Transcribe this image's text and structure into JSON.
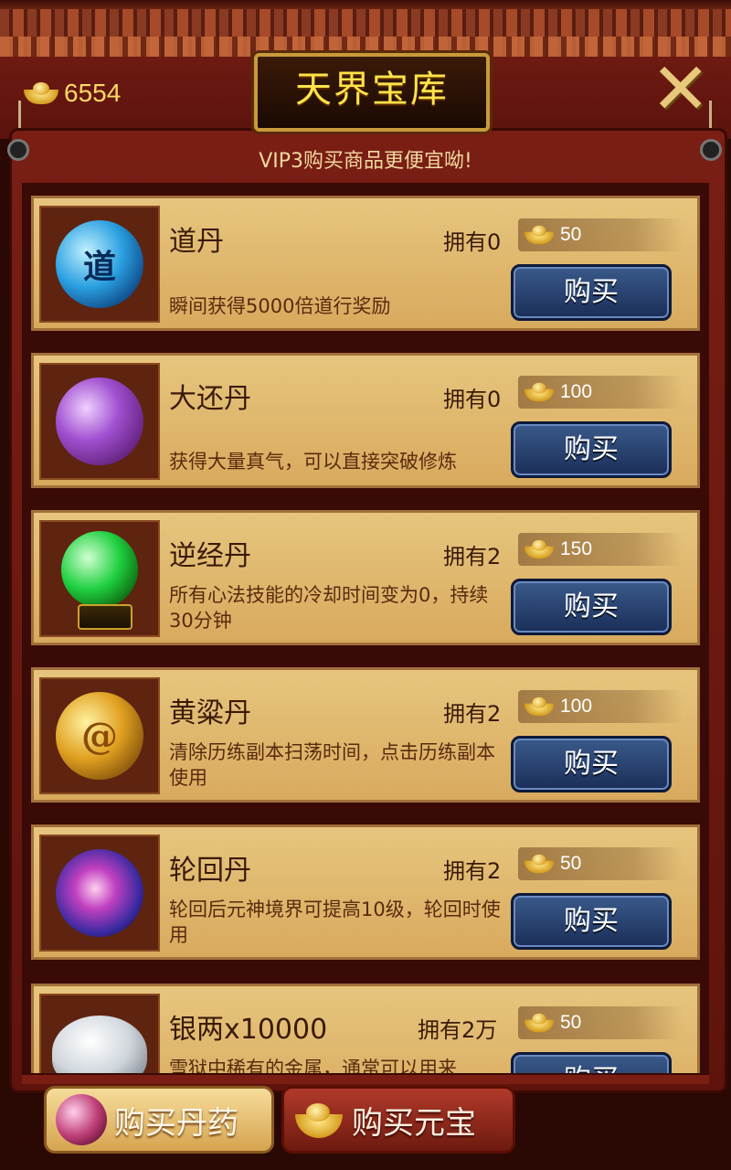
{
  "header": {
    "title": "天界宝库",
    "currency": "6554",
    "close_icon": "close-x-icon"
  },
  "vip_notice": "VIP3购买商品更便宜呦!",
  "items": [
    {
      "name": "道丹",
      "owned": "拥有0",
      "price": "50",
      "desc": "瞬间获得5000倍道行奖励",
      "icon": "blue-dan-orb-icon",
      "buy": "购买"
    },
    {
      "name": "大还丹",
      "owned": "拥有0",
      "price": "100",
      "desc": "获得大量真气，可以直接突破修炼",
      "icon": "purple-orb-icon",
      "buy": "购买"
    },
    {
      "name": "逆经丹",
      "owned": "拥有2",
      "price": "150",
      "desc": "所有心法技能的冷却时间变为0，持续30分钟",
      "icon": "green-orb-icon",
      "buy": "购买"
    },
    {
      "name": "黄粱丹",
      "owned": "拥有2",
      "price": "100",
      "desc": "清除历练副本扫荡时间，点击历练副本使用",
      "icon": "gold-orb-icon",
      "buy": "购买"
    },
    {
      "name": "轮回丹",
      "owned": "拥有2",
      "price": "50",
      "desc": "轮回后元神境界可提高10级，轮回时使用",
      "icon": "galaxy-orb-icon",
      "buy": "购买"
    },
    {
      "name": "银两x10000",
      "owned": "拥有2万",
      "price": "50",
      "desc": "雪狱中稀有的金属，通常可以用来",
      "icon": "silver-ingot-icon",
      "buy": "购买"
    }
  ],
  "tabs": [
    {
      "label": "购买丹药",
      "icon": "pill-orb-icon",
      "active": true
    },
    {
      "label": "购买元宝",
      "icon": "gold-ingot-icon",
      "active": false
    }
  ],
  "colors": {
    "panel": "#6e1a12",
    "card": "#e2bb72",
    "buy_button": "#2a4474",
    "title_text": "#ffe34a"
  }
}
